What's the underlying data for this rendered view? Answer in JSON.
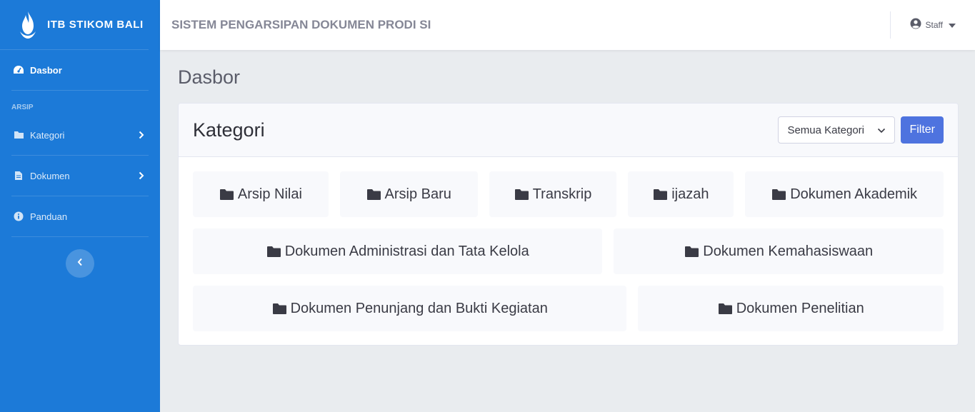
{
  "sidebar": {
    "brand": "ITB STIKOM BALI",
    "items": [
      {
        "label": "Dasbor",
        "icon": "tachometer-icon",
        "active": true
      },
      {
        "label": "Kategori",
        "icon": "folder-icon"
      },
      {
        "label": "Dokumen",
        "icon": "file-icon"
      },
      {
        "label": "Panduan",
        "icon": "info-circle-icon"
      }
    ],
    "heading": "ARSIP"
  },
  "topbar": {
    "title": "SISTEM PENGARSIPAN DOKUMEN PRODI SI",
    "user": "Staff"
  },
  "main": {
    "page_title": "Dasbor",
    "card_title": "Kategori",
    "filter_select": "Semua Kategori",
    "filter_button": "Filter",
    "categories": [
      [
        "Arsip Nilai",
        "Arsip Baru",
        "Transkrip",
        "ijazah",
        "Dokumen Akademik"
      ],
      [
        "Dokumen Administrasi dan Tata Kelola",
        "Dokumen Kemahasiswaan"
      ],
      [
        "Dokumen Penunjang dan Bukti Kegiatan",
        "Dokumen Penelitian"
      ]
    ]
  },
  "colors": {
    "sidebar": "#1c7ad8",
    "primary_button": "#4e73df",
    "background": "#e9ecef"
  }
}
